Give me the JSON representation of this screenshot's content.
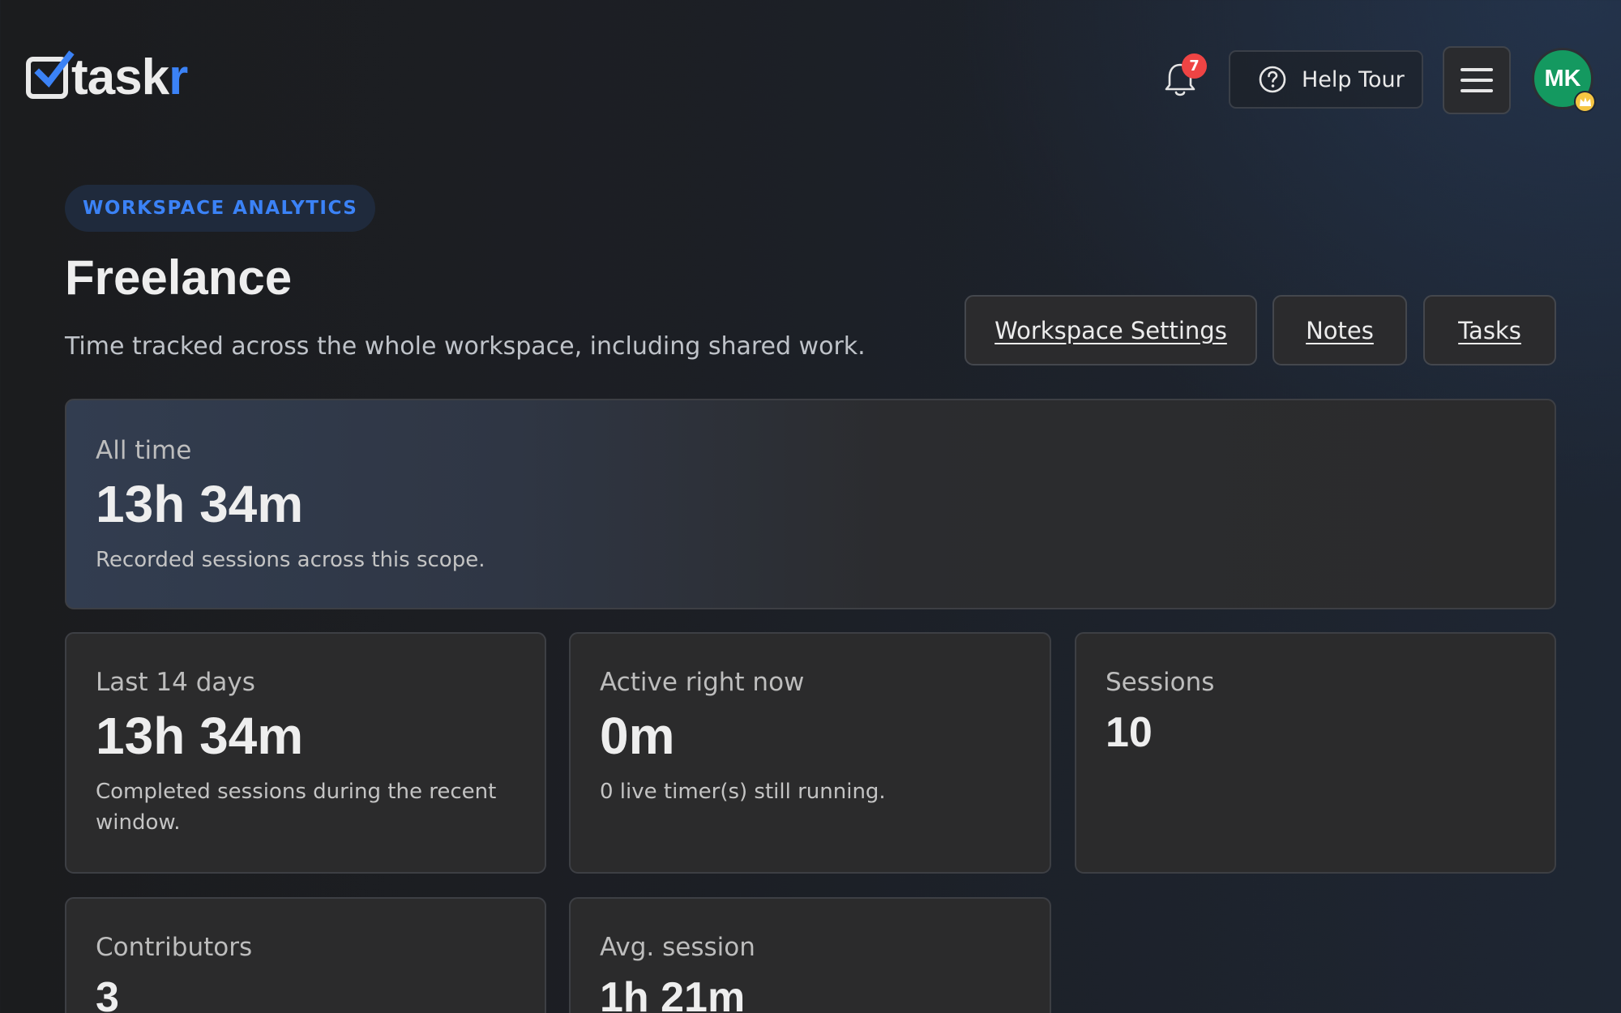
{
  "header": {
    "logo_text_main": "task",
    "logo_text_accent": "r",
    "notifications_count": "7",
    "help_label": "Help Tour",
    "avatar_initials": "MK"
  },
  "page": {
    "eyebrow": "WORKSPACE ANALYTICS",
    "title": "Freelance",
    "subtitle": "Time tracked across the whole workspace, including shared work.",
    "nav": {
      "settings": "Workspace Settings",
      "notes": "Notes",
      "tasks": "Tasks"
    }
  },
  "stats": {
    "all_time": {
      "label": "All time",
      "value": "13h 34m",
      "desc": "Recorded sessions across this scope."
    },
    "last_14": {
      "label": "Last 14 days",
      "value": "13h 34m",
      "desc": "Completed sessions during the recent window."
    },
    "active": {
      "label": "Active right now",
      "value": "0m",
      "desc": "0 live timer(s) still running."
    },
    "sessions": {
      "label": "Sessions",
      "value": "10"
    },
    "contributors": {
      "label": "Contributors",
      "value": "3"
    },
    "avg_session": {
      "label": "Avg. session",
      "value": "1h 21m"
    }
  },
  "colors": {
    "accent": "#3b82f6",
    "badge": "#ef4444",
    "avatar": "#149960",
    "crown": "#f5c542"
  }
}
